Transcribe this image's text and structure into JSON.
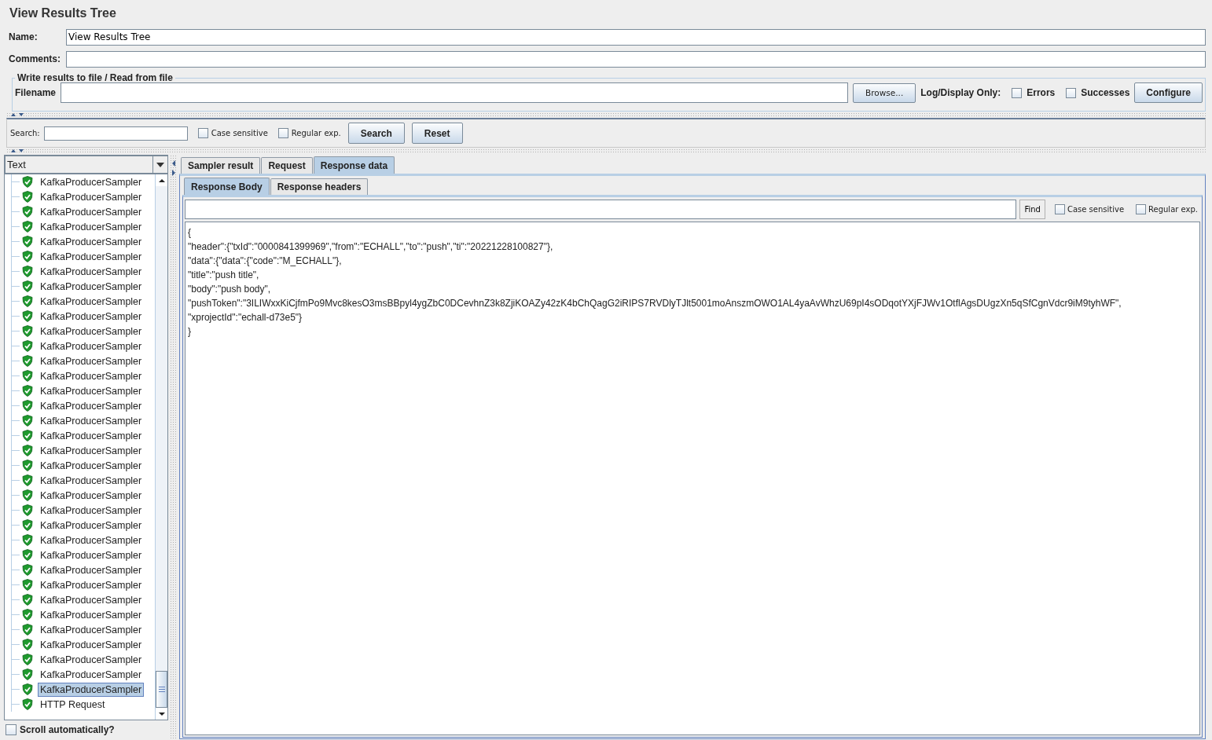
{
  "title": "View Results Tree",
  "name_field": {
    "label": "Name:",
    "value": "View Results Tree"
  },
  "comments_field": {
    "label": "Comments:"
  },
  "file_group": {
    "legend": "Write results to file / Read from file",
    "filename_label": "Filename",
    "browse": "Browse...",
    "log_label": "Log/Display Only:",
    "options": [
      {
        "label": "Errors",
        "checked": false
      },
      {
        "label": "Successes",
        "checked": false
      }
    ],
    "configure": "Configure"
  },
  "search_bar": {
    "label": "Search:",
    "options": [
      {
        "label": "Case sensitive",
        "checked": false
      },
      {
        "label": "Regular exp.",
        "checked": false
      }
    ],
    "search": "Search",
    "reset": "Reset"
  },
  "tree": {
    "header": "Text",
    "items": [
      {
        "label": "KafkaProducerSampler",
        "selected": false
      },
      {
        "label": "KafkaProducerSampler",
        "selected": false
      },
      {
        "label": "KafkaProducerSampler",
        "selected": false
      },
      {
        "label": "KafkaProducerSampler",
        "selected": false
      },
      {
        "label": "KafkaProducerSampler",
        "selected": false
      },
      {
        "label": "KafkaProducerSampler",
        "selected": false
      },
      {
        "label": "KafkaProducerSampler",
        "selected": false
      },
      {
        "label": "KafkaProducerSampler",
        "selected": false
      },
      {
        "label": "KafkaProducerSampler",
        "selected": false
      },
      {
        "label": "KafkaProducerSampler",
        "selected": false
      },
      {
        "label": "KafkaProducerSampler",
        "selected": false
      },
      {
        "label": "KafkaProducerSampler",
        "selected": false
      },
      {
        "label": "KafkaProducerSampler",
        "selected": false
      },
      {
        "label": "KafkaProducerSampler",
        "selected": false
      },
      {
        "label": "KafkaProducerSampler",
        "selected": false
      },
      {
        "label": "KafkaProducerSampler",
        "selected": false
      },
      {
        "label": "KafkaProducerSampler",
        "selected": false
      },
      {
        "label": "KafkaProducerSampler",
        "selected": false
      },
      {
        "label": "KafkaProducerSampler",
        "selected": false
      },
      {
        "label": "KafkaProducerSampler",
        "selected": false
      },
      {
        "label": "KafkaProducerSampler",
        "selected": false
      },
      {
        "label": "KafkaProducerSampler",
        "selected": false
      },
      {
        "label": "KafkaProducerSampler",
        "selected": false
      },
      {
        "label": "KafkaProducerSampler",
        "selected": false
      },
      {
        "label": "KafkaProducerSampler",
        "selected": false
      },
      {
        "label": "KafkaProducerSampler",
        "selected": false
      },
      {
        "label": "KafkaProducerSampler",
        "selected": false
      },
      {
        "label": "KafkaProducerSampler",
        "selected": false
      },
      {
        "label": "KafkaProducerSampler",
        "selected": false
      },
      {
        "label": "KafkaProducerSampler",
        "selected": false
      },
      {
        "label": "KafkaProducerSampler",
        "selected": false
      },
      {
        "label": "KafkaProducerSampler",
        "selected": false
      },
      {
        "label": "KafkaProducerSampler",
        "selected": false
      },
      {
        "label": "KafkaProducerSampler",
        "selected": false
      },
      {
        "label": "KafkaProducerSampler",
        "selected": true
      },
      {
        "label": "HTTP Request",
        "selected": false
      }
    ]
  },
  "scroll_auto": {
    "label": "Scroll automatically?",
    "checked": false
  },
  "tabs": [
    {
      "label": "Sampler result",
      "selected": false
    },
    {
      "label": "Request",
      "selected": false
    },
    {
      "label": "Response data",
      "selected": true
    }
  ],
  "sub_tabs": [
    {
      "label": "Response Body",
      "selected": true
    },
    {
      "label": "Response headers",
      "selected": false
    }
  ],
  "find_bar": {
    "find": "Find",
    "options": [
      {
        "label": "Case sensitive",
        "checked": false
      },
      {
        "label": "Regular exp.",
        "checked": false
      }
    ]
  },
  "body_lines": [
    "{",
    "\"header\":{\"txId\":\"0000841399969\",\"from\":\"ECHALL\",\"to\":\"push\",\"ti\":\"20221228100827\"},",
    "\"data\":{\"data\":{\"code\":\"M_ECHALL\"},",
    "\"title\":\"push title\",",
    "\"body\":\"push body\",",
    "\"pushToken\":\"3ILIWxxKiCjfmPo9Mvc8kesO3msBBpyl4ygZbC0DCevhnZ3k8ZjiKOAZy42zK4bChQagG2iRIPS7RVDlyTJlt5001moAnszmOWO1AL4yaAvWhzU69pI4sODqotYXjFJWv1OtflAgsDUgzXn5qSfCgnVdcr9iM9tyhWF\",",
    "\"xprojectId\":\"echall-d73e5\"}",
    "}"
  ]
}
